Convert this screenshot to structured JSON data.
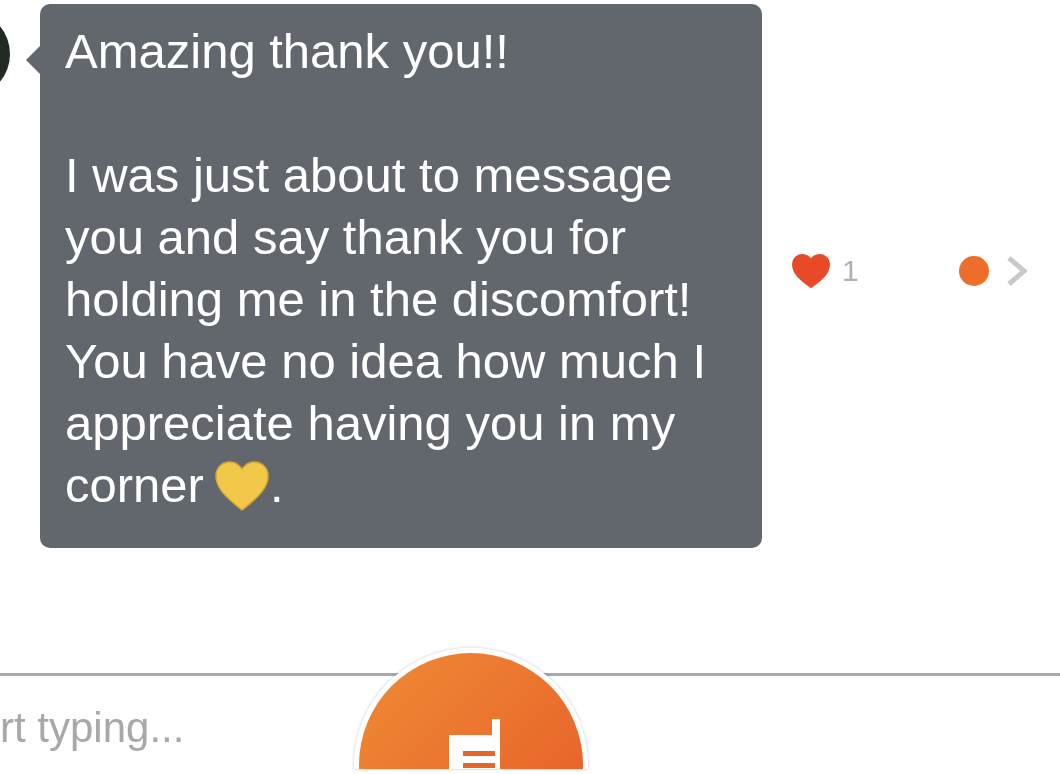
{
  "message": {
    "paragraphs": [
      {
        "text": "Amazing thank you!!",
        "emoji": false
      },
      {
        "text": "I was just about to message you and say thank you for holding me in the discomfort! You have no idea how much I appreciate having you in my corner",
        "emoji": true,
        "after": "."
      }
    ],
    "likes": "1",
    "liked": true
  },
  "composer": {
    "placeholder": "rt typing..."
  }
}
